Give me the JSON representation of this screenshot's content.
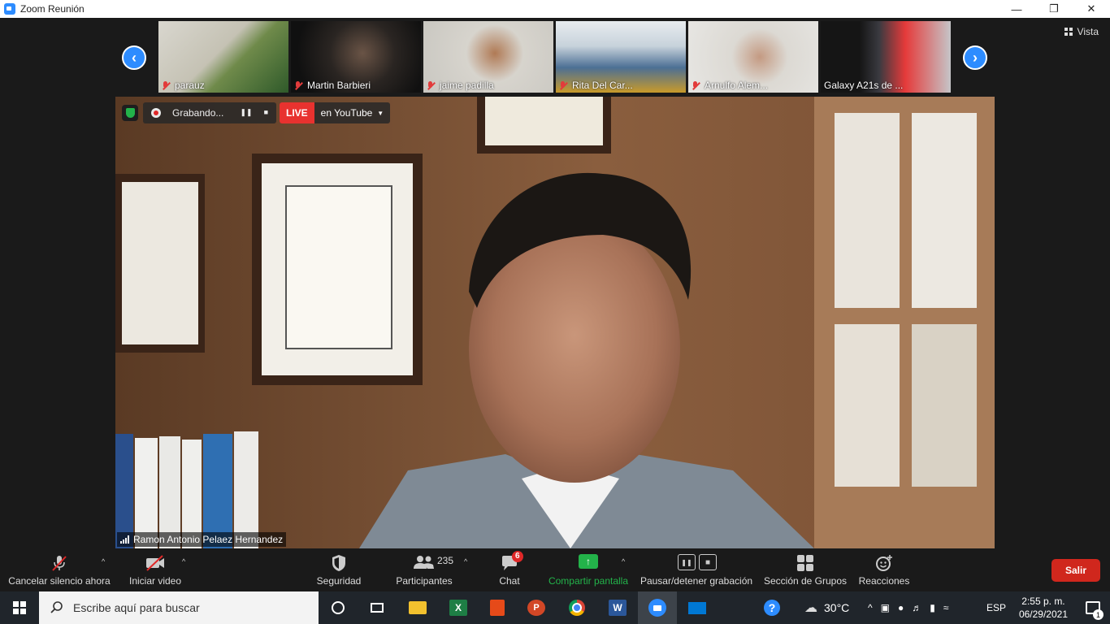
{
  "window": {
    "title": "Zoom Reunión"
  },
  "gallery": {
    "participants": [
      {
        "name": "parauz",
        "muted": true
      },
      {
        "name": "Martin Barbieri",
        "muted": true
      },
      {
        "name": "jaime padilla",
        "muted": true
      },
      {
        "name": "Rita Del Car...",
        "muted": true
      },
      {
        "name": "Arnulfo Alem...",
        "muted": true
      },
      {
        "name": "Galaxy A21s de ...",
        "muted": false
      }
    ],
    "view_label": "Vista"
  },
  "recording": {
    "status": "Grabando...",
    "live_label": "LIVE",
    "live_target": "en YouTube"
  },
  "speaker": {
    "name": "Ramon Antonio Pelaez Hernandez"
  },
  "toolbar": {
    "mute_label": "Cancelar silencio ahora",
    "video_label": "Iniciar video",
    "security_label": "Seguridad",
    "participants_label": "Participantes",
    "participants_count": "235",
    "chat_label": "Chat",
    "chat_badge": "6",
    "share_label": "Compartir pantalla",
    "pause_rec_label": "Pausar/detener grabación",
    "breakout_label": "Sección de Grupos",
    "reactions_label": "Reacciones",
    "leave_label": "Salir"
  },
  "taskbar": {
    "search_placeholder": "Escribe aquí para buscar",
    "weather": "30°C",
    "language": "ESP",
    "time": "2:55 p. m.",
    "date": "06/29/2021",
    "notifications": "1"
  },
  "colors": {
    "zoom_blue": "#2d8cff",
    "leave_red": "#d0271d",
    "share_green": "#23b34a",
    "live_red": "#e8322f"
  }
}
